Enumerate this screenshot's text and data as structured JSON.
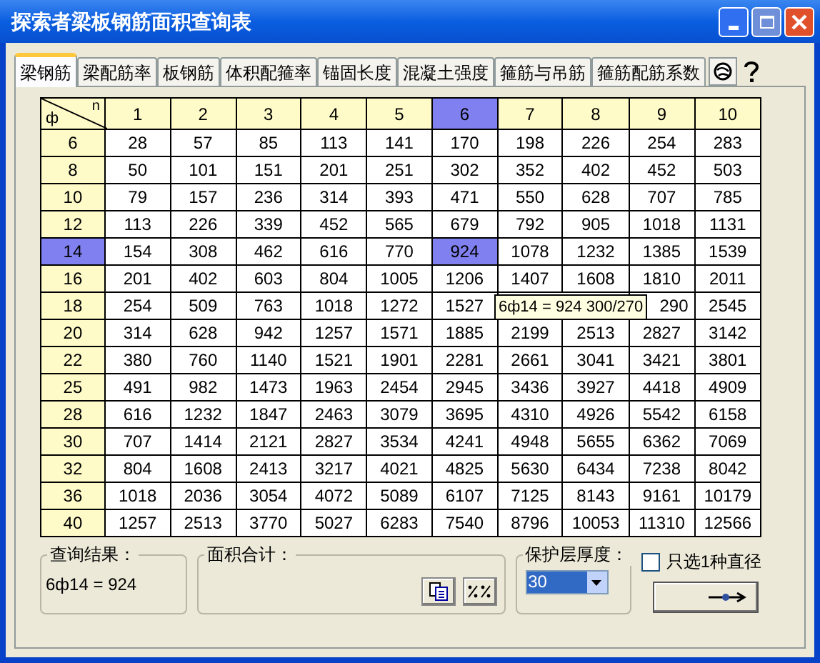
{
  "window": {
    "title": "探索者梁板钢筋面积查询表"
  },
  "tabs": [
    {
      "label": "梁钢筋",
      "selected": true
    },
    {
      "label": "梁配筋率",
      "selected": false
    },
    {
      "label": "板钢筋",
      "selected": false
    },
    {
      "label": "体积配箍率",
      "selected": false
    },
    {
      "label": "锚固长度",
      "selected": false
    },
    {
      "label": "混凝土强度",
      "selected": false
    },
    {
      "label": "箍筋与吊筋",
      "selected": false
    },
    {
      "label": "箍筋配筋系数",
      "selected": false
    }
  ],
  "table": {
    "corner_left": "ф",
    "corner_right": "n",
    "columns": [
      {
        "label": "1",
        "selected": false
      },
      {
        "label": "2",
        "selected": false
      },
      {
        "label": "3",
        "selected": false
      },
      {
        "label": "4",
        "selected": false
      },
      {
        "label": "5",
        "selected": false
      },
      {
        "label": "6",
        "selected": true
      },
      {
        "label": "7",
        "selected": false
      },
      {
        "label": "8",
        "selected": false
      },
      {
        "label": "9",
        "selected": false
      },
      {
        "label": "10",
        "selected": false
      }
    ],
    "rows": [
      {
        "diameter": "6",
        "selected": false,
        "values": [
          "28",
          "57",
          "85",
          "113",
          "141",
          "170",
          "198",
          "226",
          "254",
          "283"
        ]
      },
      {
        "diameter": "8",
        "selected": false,
        "values": [
          "50",
          "101",
          "151",
          "201",
          "251",
          "302",
          "352",
          "402",
          "452",
          "503"
        ]
      },
      {
        "diameter": "10",
        "selected": false,
        "values": [
          "79",
          "157",
          "236",
          "314",
          "393",
          "471",
          "550",
          "628",
          "707",
          "785"
        ]
      },
      {
        "diameter": "12",
        "selected": false,
        "values": [
          "113",
          "226",
          "339",
          "452",
          "565",
          "679",
          "792",
          "905",
          "1018",
          "1131"
        ]
      },
      {
        "diameter": "14",
        "selected": true,
        "values": [
          "154",
          "308",
          "462",
          "616",
          "770",
          "924",
          "1078",
          "1232",
          "1385",
          "1539"
        ]
      },
      {
        "diameter": "16",
        "selected": false,
        "values": [
          "201",
          "402",
          "603",
          "804",
          "1005",
          "1206",
          "1407",
          "1608",
          "1810",
          "2011"
        ]
      },
      {
        "diameter": "18",
        "selected": false,
        "values": [
          "254",
          "509",
          "763",
          "1018",
          "1272",
          "1527"
        ],
        "values_after_tooltip": [
          "290",
          "2545"
        ]
      },
      {
        "diameter": "20",
        "selected": false,
        "values": [
          "314",
          "628",
          "942",
          "1257",
          "1571",
          "1885",
          "2199",
          "2513",
          "2827",
          "3142"
        ]
      },
      {
        "diameter": "22",
        "selected": false,
        "values": [
          "380",
          "760",
          "1140",
          "1521",
          "1901",
          "2281",
          "2661",
          "3041",
          "3421",
          "3801"
        ]
      },
      {
        "diameter": "25",
        "selected": false,
        "values": [
          "491",
          "982",
          "1473",
          "1963",
          "2454",
          "2945",
          "3436",
          "3927",
          "4418",
          "4909"
        ]
      },
      {
        "diameter": "28",
        "selected": false,
        "values": [
          "616",
          "1232",
          "1847",
          "2463",
          "3079",
          "3695",
          "4310",
          "4926",
          "5542",
          "6158"
        ]
      },
      {
        "diameter": "30",
        "selected": false,
        "values": [
          "707",
          "1414",
          "2121",
          "2827",
          "3534",
          "4241",
          "4948",
          "5655",
          "6362",
          "7069"
        ]
      },
      {
        "diameter": "32",
        "selected": false,
        "values": [
          "804",
          "1608",
          "2413",
          "3217",
          "4021",
          "4825",
          "5630",
          "6434",
          "7238",
          "8042"
        ]
      },
      {
        "diameter": "36",
        "selected": false,
        "values": [
          "1018",
          "2036",
          "3054",
          "4072",
          "5089",
          "6107",
          "7125",
          "8143",
          "9161",
          "10179"
        ]
      },
      {
        "diameter": "40",
        "selected": false,
        "values": [
          "1257",
          "2513",
          "3770",
          "5027",
          "6283",
          "7540",
          "8796",
          "10053",
          "11310",
          "12566"
        ]
      }
    ],
    "tooltip": "6ф14 = 924 300/270"
  },
  "result": {
    "label": "查询结果：",
    "value": "6ф14 = 924"
  },
  "area_total": {
    "label": "面积合计："
  },
  "cover": {
    "label": "保护层厚度：",
    "value": "30"
  },
  "single_diameter": {
    "label": "只选1种直径",
    "checked": false
  }
}
